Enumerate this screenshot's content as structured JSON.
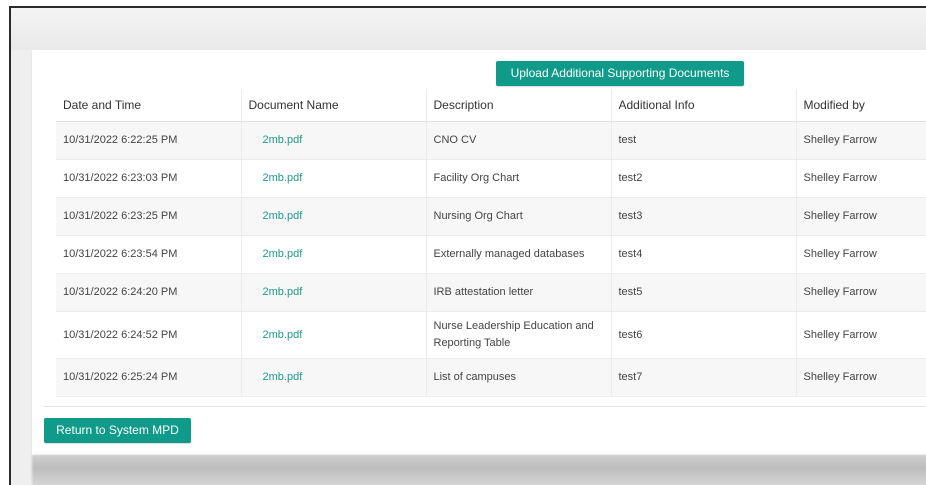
{
  "actions": {
    "upload_label": "Upload Additional Supporting Documents",
    "return_label": "Return to System MPD"
  },
  "table": {
    "columns": [
      "Date and Time",
      "Document Name",
      "Description",
      "Additional Info",
      "Modified by"
    ],
    "rows": [
      {
        "date": "10/31/2022 6:22:25 PM",
        "document": "2mb.pdf",
        "description": "CNO CV",
        "info": "test",
        "modified_by": "Shelley Farrow"
      },
      {
        "date": "10/31/2022 6:23:03 PM",
        "document": "2mb.pdf",
        "description": "Facility Org Chart",
        "info": "test2",
        "modified_by": "Shelley Farrow"
      },
      {
        "date": "10/31/2022 6:23:25 PM",
        "document": "2mb.pdf",
        "description": "Nursing Org Chart",
        "info": "test3",
        "modified_by": "Shelley Farrow"
      },
      {
        "date": "10/31/2022 6:23:54 PM",
        "document": "2mb.pdf",
        "description": "Externally managed databases",
        "info": "test4",
        "modified_by": "Shelley Farrow"
      },
      {
        "date": "10/31/2022 6:24:20 PM",
        "document": "2mb.pdf",
        "description": "IRB attestation letter",
        "info": "test5",
        "modified_by": "Shelley Farrow"
      },
      {
        "date": "10/31/2022 6:24:52 PM",
        "document": "2mb.pdf",
        "description": "Nurse Leadership Education and Reporting Table",
        "info": "test6",
        "modified_by": "Shelley Farrow"
      },
      {
        "date": "10/31/2022 6:25:24 PM",
        "document": "2mb.pdf",
        "description": "List of campuses",
        "info": "test7",
        "modified_by": "Shelley Farrow"
      }
    ]
  },
  "colors": {
    "accent": "#0f9a8a",
    "link": "#1e9a8a"
  }
}
